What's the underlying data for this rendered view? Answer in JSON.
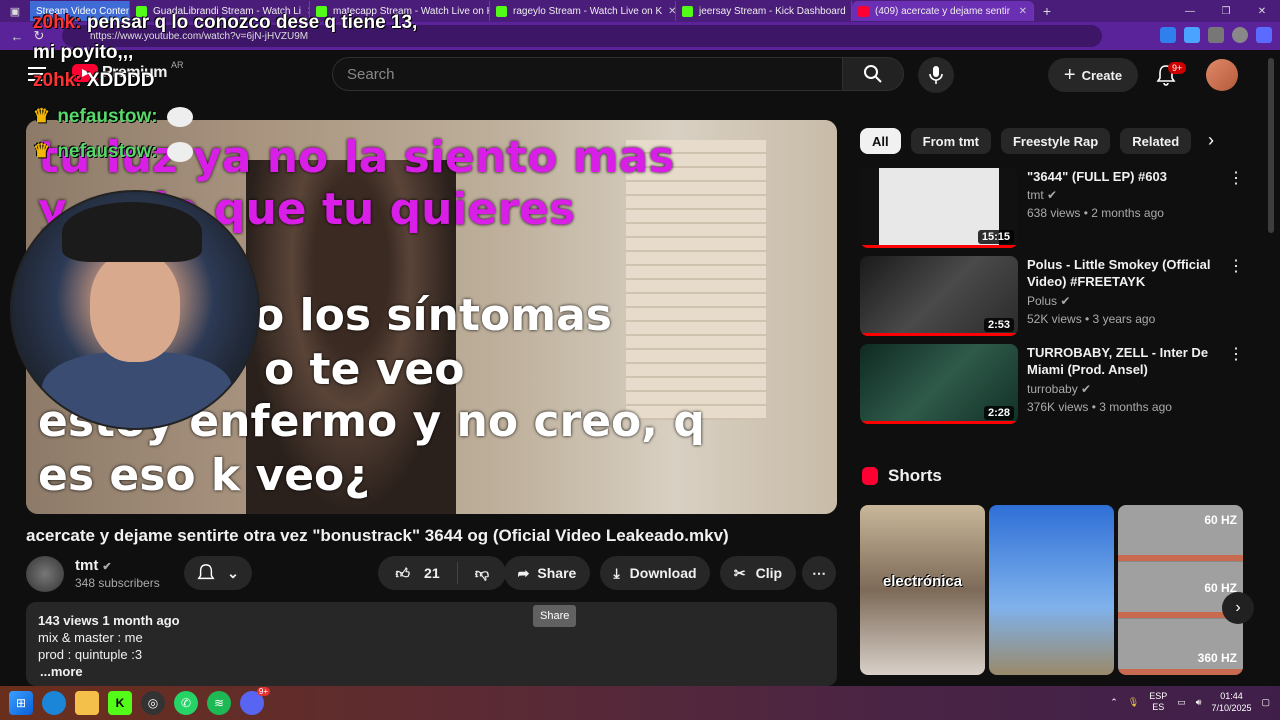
{
  "browser": {
    "tabs": [
      {
        "label": "Stream Video Content",
        "favicon_color": "#3f6bd6",
        "special": true
      },
      {
        "label": "GuadaLibrandi Stream - Watch Li",
        "favicon_color": "#53fc18"
      },
      {
        "label": "matecapp Stream - Watch Live on K",
        "favicon_color": "#53fc18"
      },
      {
        "label": "rageylo Stream - Watch Live on K",
        "favicon_color": "#53fc18"
      },
      {
        "label": "jeersay Stream - Kick Dashboard",
        "favicon_color": "#53fc18"
      },
      {
        "label": "(409) acercate y dejame sentir",
        "favicon_color": "#ff0033",
        "active": true
      }
    ],
    "url": "https://www.youtube.com/watch?v=6jN-jHVZU9M"
  },
  "header": {
    "logo_text": "Premium",
    "region": "AR",
    "search_placeholder": "Search",
    "create_label": "Create",
    "notif_count": "9+"
  },
  "overlay": {
    "chat": [
      {
        "user": "z0hk:",
        "message": "pensar q lo conozco dese q tiene 13,"
      },
      {
        "user": "",
        "message": "mi poyito,,,"
      },
      {
        "user": "z0hk:",
        "message": "XDDDD"
      },
      {
        "user": "nefaustow:",
        "message": ""
      },
      {
        "user": "nefaustow:",
        "message": ""
      }
    ],
    "lyrics": {
      "purple_1": "tu luz ya no la siento mas",
      "purple_2": "y       se lo que tu quieres",
      "white_1": "o los síntomas",
      "white_2": "o te veo",
      "white_3": "estoy enfermo y no creo, q",
      "white_4": "es eso k veo¿"
    }
  },
  "video": {
    "title": "acercate y dejame sentirte otra vez \"bonustrack\" 3644 og (Oficial Video Leakeado.mkv)",
    "channel": "tmt",
    "subscribers": "348 subscribers",
    "likes": "21",
    "share_label": "Share",
    "download_label": "Download",
    "clip_label": "Clip",
    "tooltip": "Share",
    "views_date": "143 views  1 month ago",
    "description_lines": [
      "mix & master : me",
      "prod : quintuple :3"
    ],
    "more_label": "...more"
  },
  "sidebar": {
    "chips": [
      "All",
      "From tmt",
      "Freestyle Rap",
      "Related"
    ],
    "recommendations": [
      {
        "title": "\"3644\" (FULL EP) #603",
        "channel": "tmt",
        "meta": "638 views • 2 months ago",
        "duration": "15:15"
      },
      {
        "title": "Polus - Little Smokey (Official Video) #FREETAYK",
        "channel": "Polus",
        "meta": "52K views • 3 years ago",
        "duration": "2:53"
      },
      {
        "title": "TURROBABY, ZELL - Inter De Miami (Prod. Ansel)",
        "channel": "turrobaby",
        "meta": "376K views • 3 months ago",
        "duration": "2:28"
      }
    ],
    "shorts_title": "Shorts",
    "shorts": [
      {
        "caption": "electrónica"
      },
      {
        "caption": ""
      },
      {
        "caption_top": "60 HZ",
        "caption_mid": "60 HZ",
        "caption_bot": "360 HZ"
      }
    ]
  },
  "taskbar": {
    "lang_top": "ESP",
    "lang_bot": "ES",
    "time": "01:44",
    "date": "7/10/2025",
    "discord_badge": "9+"
  }
}
